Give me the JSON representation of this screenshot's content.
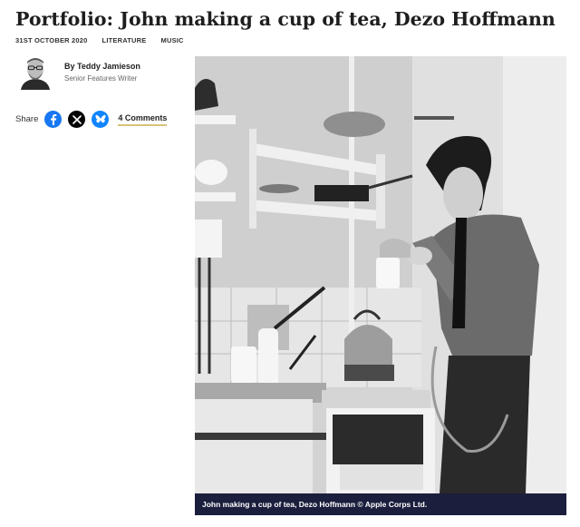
{
  "article": {
    "title": "Portfolio: John making a cup of tea, Dezo Hoffmann",
    "date": "31ST OCTOBER 2020",
    "tags": [
      "LITERATURE",
      "MUSIC"
    ]
  },
  "author": {
    "name": "By Teddy Jamieson",
    "role": "Senior Features Writer"
  },
  "share": {
    "label": "Share",
    "icons": [
      "facebook-icon",
      "x-icon",
      "bluesky-icon"
    ],
    "comments_label": "4 Comments"
  },
  "photo": {
    "caption": "John making a cup of tea, Dezo Hoffmann © Apple Corps Ltd."
  },
  "colors": {
    "caption_background": "#1b1e3d",
    "facebook": "#1877f2",
    "x": "#000000",
    "bluesky": "#1185fe",
    "comments_underline": "#d9c27a"
  }
}
